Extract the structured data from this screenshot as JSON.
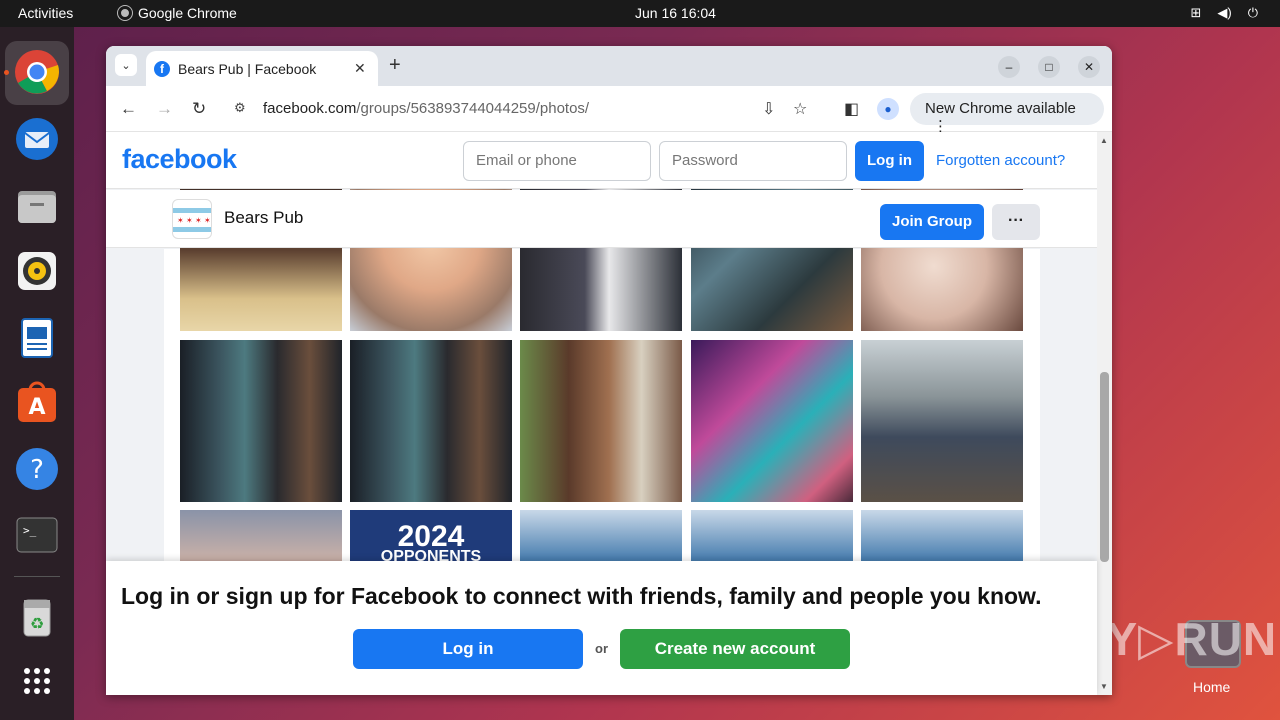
{
  "topbar": {
    "activities": "Activities",
    "app_name": "Google Chrome",
    "clock": "Jun 16  16:04",
    "tray_icons": [
      "network-icon",
      "volume-icon",
      "power-icon"
    ]
  },
  "dock": {
    "items": [
      "chrome-icon",
      "thunderbird-icon",
      "files-icon",
      "rhythmbox-icon",
      "writer-icon",
      "software-center-icon",
      "help-icon",
      "terminal-icon",
      "trash-icon",
      "app-grid-icon"
    ]
  },
  "desktop": {
    "home_label": "Home",
    "watermark": "ANY▷RUN"
  },
  "browser": {
    "tab_title": "Bears Pub | Facebook",
    "url_host": "facebook.com",
    "url_path": "/groups/563893744044259/photos/",
    "new_chrome": "New Chrome available"
  },
  "facebook": {
    "logo": "facebook",
    "email_placeholder": "Email or phone",
    "password_placeholder": "Password",
    "login_label": "Log in",
    "forgot_label": "Forgotten account?",
    "group_name": "Bears Pub",
    "join_label": "Join Group",
    "more_label": "···",
    "photos_text": [
      "2024",
      "OPPONENTS"
    ],
    "banner_text": "Log in or sign up for Facebook to connect with friends, family and people you know.",
    "banner_login": "Log in",
    "banner_or": "or",
    "banner_create": "Create new account"
  },
  "colors": {
    "fb_blue": "#1877f2",
    "fb_green": "#2ea043",
    "ubuntu_orange": "#e95420"
  }
}
